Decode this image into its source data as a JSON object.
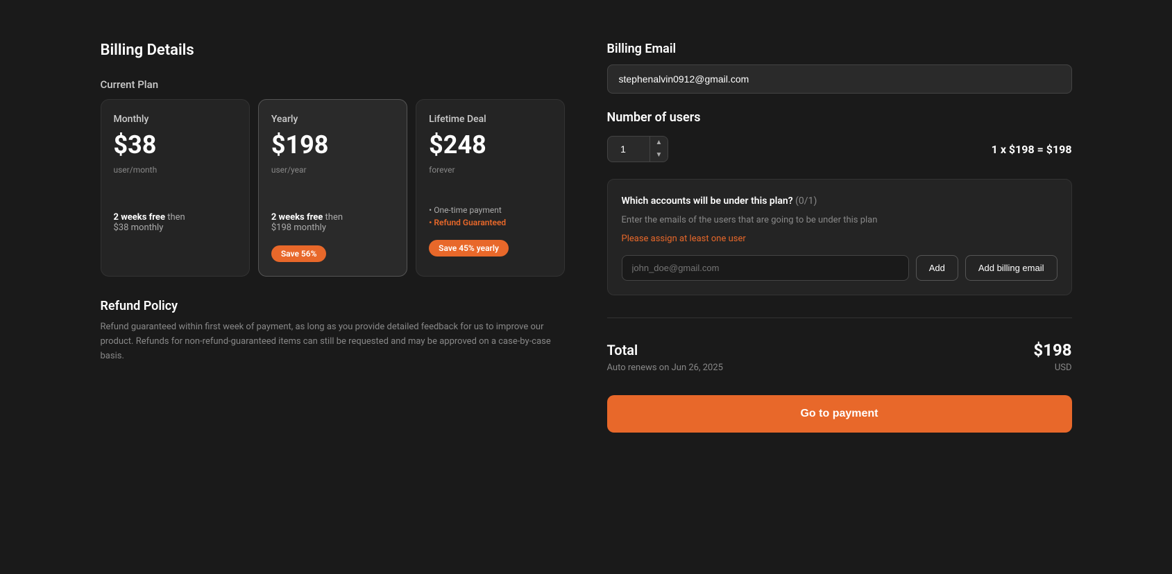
{
  "page": {
    "billing_details_title": "Billing Details",
    "current_plan_label": "Current Plan",
    "plans": [
      {
        "id": "monthly",
        "name": "Monthly",
        "price": "$38",
        "period": "user/month",
        "free_trial": "2 weeks free",
        "then_text": "then $38 monthly",
        "selected": false,
        "save_badge": null,
        "features": []
      },
      {
        "id": "yearly",
        "name": "Yearly",
        "price": "$198",
        "period": "user/year",
        "free_trial": "2 weeks free",
        "then_text": "then $198 monthly",
        "selected": true,
        "save_badge": "Save 56%",
        "features": []
      },
      {
        "id": "lifetime",
        "name": "Lifetime Deal",
        "price": "$248",
        "period": "forever",
        "free_trial": null,
        "then_text": null,
        "selected": false,
        "save_badge": "Save 45% yearly",
        "features": [
          {
            "text": "One-time payment",
            "highlight": false
          },
          {
            "text": "Refund Guaranteed",
            "highlight": true
          }
        ]
      }
    ],
    "refund_policy_title": "Refund Policy",
    "refund_policy_text": "Refund guaranteed within first week of payment, as long as you provide detailed feedback for us to improve our product. Refunds for non-refund-guaranteed items can still be requested and may be approved on a case-by-case basis.",
    "billing_email_title": "Billing Email",
    "billing_email_value": "stephenalvin0912@gmail.com",
    "number_of_users_title": "Number of users",
    "users_count": "1",
    "price_calculation": "1 x $198 = $198",
    "accounts_title": "Which accounts will be under this plan?",
    "accounts_count": "(0/1)",
    "accounts_description": "Enter the emails of the users that are going to be under this plan",
    "accounts_error": "Please assign at least one user",
    "accounts_email_placeholder": "john_doe@gmail.com",
    "btn_add_label": "Add",
    "btn_add_billing_label": "Add billing email",
    "total_label": "Total",
    "total_amount": "$198",
    "total_renewal": "Auto renews on Jun 26, 2025",
    "total_currency": "USD",
    "btn_payment_label": "Go to payment"
  }
}
